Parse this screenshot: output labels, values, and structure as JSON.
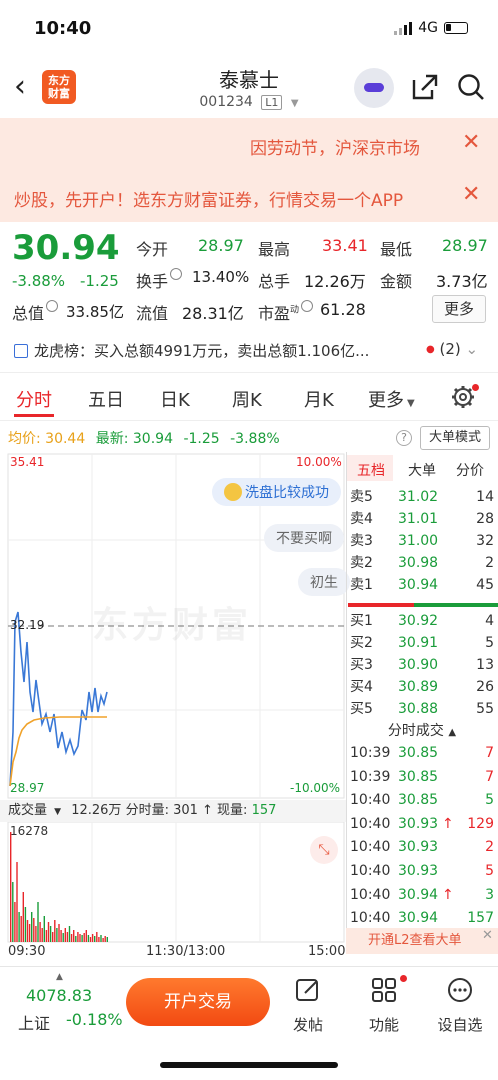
{
  "status_bar": {
    "time": "10:40",
    "network": "4G"
  },
  "header": {
    "logo_text": "东方财富",
    "stock_name": "泰慕士",
    "stock_code": "001234",
    "level": "L1"
  },
  "banners": {
    "notice": "因劳动节，沪深京市场",
    "ad": "炒股，先开户！选东方财富证券，行情交易一个APP"
  },
  "quote": {
    "price": "30.94",
    "change_pct": "-3.88%",
    "change_abs": "-1.25",
    "fields": [
      {
        "label": "今开",
        "value": "28.97",
        "color": "#1a9c3a"
      },
      {
        "label": "最高",
        "value": "33.41",
        "color": "#e8262a"
      },
      {
        "label": "最低",
        "value": "28.97",
        "color": "#1a9c3a"
      },
      {
        "label": "换手",
        "value": "13.40%",
        "color": "#222"
      },
      {
        "label": "总手",
        "value": "12.26万",
        "color": "#222"
      },
      {
        "label": "金额",
        "value": "3.73亿",
        "color": "#222"
      },
      {
        "label": "总值",
        "value": "33.85亿",
        "color": "#222"
      },
      {
        "label": "流值",
        "value": "28.31亿",
        "color": "#222"
      },
      {
        "label": "市盈",
        "value": "61.28",
        "color": "#222"
      }
    ],
    "pe_sup": "动",
    "more_label": "更多"
  },
  "dragon_tiger": {
    "label": "龙虎榜：",
    "text": "买入总额4991万元，卖出总额1.106亿...",
    "count": "(2)"
  },
  "tabs": [
    "分时",
    "五日",
    "日K",
    "周K",
    "月K",
    "更多"
  ],
  "info_line": {
    "avg_label": "均价:",
    "avg_value": "30.44",
    "latest_label": "最新:",
    "latest_value": "30.94",
    "chg": "-1.25",
    "pct": "-3.88%",
    "big_order_label": "大单模式"
  },
  "chart_labels": {
    "top_price": "35.41",
    "top_pct": "10.00%",
    "bottom_price": "28.97",
    "bottom_pct": "-10.00%",
    "ref_price": "32.19",
    "watermark": "东方财富"
  },
  "bubbles": [
    "洗盘比较成功",
    "不要买啊",
    "初生"
  ],
  "volume": {
    "label": "成交量",
    "summary": "12.26万  分时量: 301 ↑  现量: ",
    "current": "157",
    "peak": "16278"
  },
  "time_axis": [
    "09:30",
    "11:30/13:00",
    "15:00"
  ],
  "right_panel": {
    "tabs": [
      "五档",
      "大单",
      "分价"
    ],
    "asks": [
      {
        "label": "卖5",
        "price": "31.02",
        "vol": "14"
      },
      {
        "label": "卖4",
        "price": "31.01",
        "vol": "28"
      },
      {
        "label": "卖3",
        "price": "31.00",
        "vol": "32"
      },
      {
        "label": "卖2",
        "price": "30.98",
        "vol": "2"
      },
      {
        "label": "卖1",
        "price": "30.94",
        "vol": "45"
      }
    ],
    "bids": [
      {
        "label": "买1",
        "price": "30.92",
        "vol": "4"
      },
      {
        "label": "买2",
        "price": "30.91",
        "vol": "5"
      },
      {
        "label": "买3",
        "price": "30.90",
        "vol": "13"
      },
      {
        "label": "买4",
        "price": "30.89",
        "vol": "26"
      },
      {
        "label": "买5",
        "price": "30.88",
        "vol": "55"
      }
    ],
    "trades_title": "分时成交",
    "trades": [
      {
        "time": "10:39",
        "price": "30.85",
        "vol": "7",
        "dir": "",
        "vol_color": "#e8262a"
      },
      {
        "time": "10:39",
        "price": "30.85",
        "vol": "7",
        "dir": "",
        "vol_color": "#e8262a"
      },
      {
        "time": "10:40",
        "price": "30.85",
        "vol": "5",
        "dir": "",
        "vol_color": "#1a9c3a"
      },
      {
        "time": "10:40",
        "price": "30.93",
        "vol": "129",
        "dir": "↑",
        "vol_color": "#e8262a"
      },
      {
        "time": "10:40",
        "price": "30.93",
        "vol": "2",
        "dir": "",
        "vol_color": "#e8262a"
      },
      {
        "time": "10:40",
        "price": "30.93",
        "vol": "5",
        "dir": "",
        "vol_color": "#e8262a"
      },
      {
        "time": "10:40",
        "price": "30.94",
        "vol": "3",
        "dir": "↑",
        "vol_color": "#1a9c3a"
      },
      {
        "time": "10:40",
        "price": "30.94",
        "vol": "157",
        "dir": "",
        "vol_color": "#1a9c3a"
      }
    ],
    "l2_banner": "开通L2查看大单"
  },
  "bottom_nav": {
    "index_value": "4078.83",
    "index_name": "上证",
    "index_pct": "-0.18%",
    "trade_button": "开户交易",
    "items": [
      "发帖",
      "功能",
      "设自选"
    ]
  }
}
